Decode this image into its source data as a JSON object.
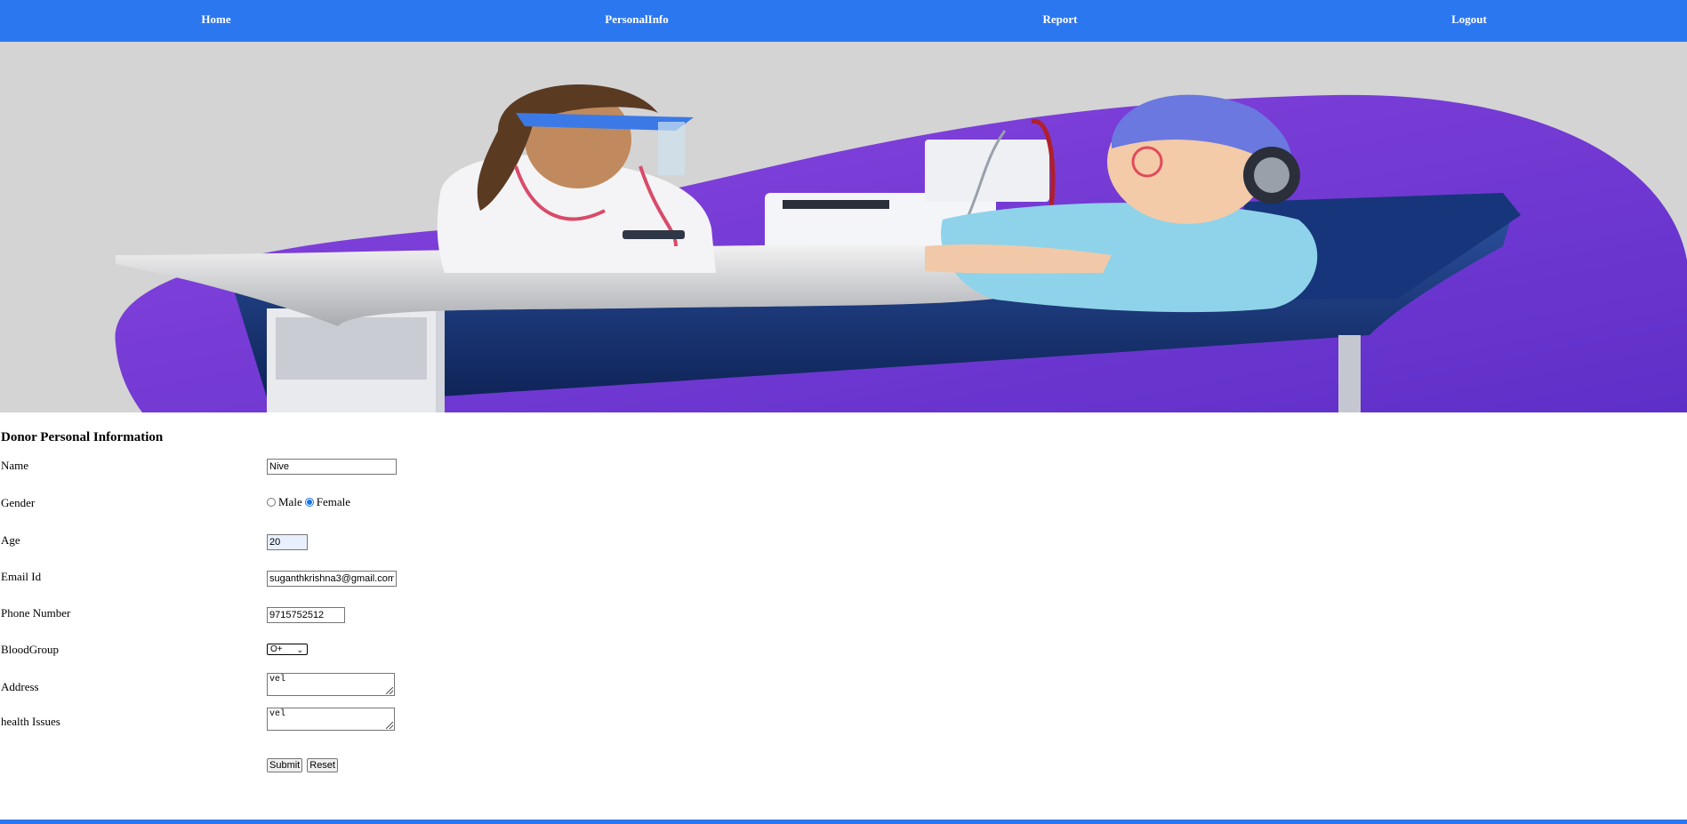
{
  "nav": {
    "items": [
      {
        "label": "Home"
      },
      {
        "label": "PersonalInfo"
      },
      {
        "label": "Report"
      },
      {
        "label": "Logout"
      }
    ]
  },
  "form": {
    "title": "Donor Personal Information",
    "name": {
      "label": "Name",
      "value": "Nive"
    },
    "gender": {
      "label": "Gender",
      "options": [
        "Male",
        "Female"
      ],
      "selected": "Female"
    },
    "age": {
      "label": "Age",
      "value": "20"
    },
    "email": {
      "label": "Email Id",
      "value": "suganthkrishna3@gmail.com"
    },
    "phone": {
      "label": "Phone Number",
      "value": "9715752512"
    },
    "blood_group": {
      "label": "BloodGroup",
      "value": "O+"
    },
    "address": {
      "label": "Address",
      "value": "vel"
    },
    "health": {
      "label": "health Issues",
      "value": "vel"
    },
    "submit_label": "Submit",
    "reset_label": "Reset"
  },
  "colors": {
    "nav_bg": "#2b77ef",
    "hero_bg": "#d4d4d4",
    "accent_purple": "#7a3fd8",
    "radio_checked": "#1a73e8"
  },
  "icons": {
    "select_arrow": "chevron-down-icon",
    "textarea_resize": "resize-grip-icon"
  }
}
